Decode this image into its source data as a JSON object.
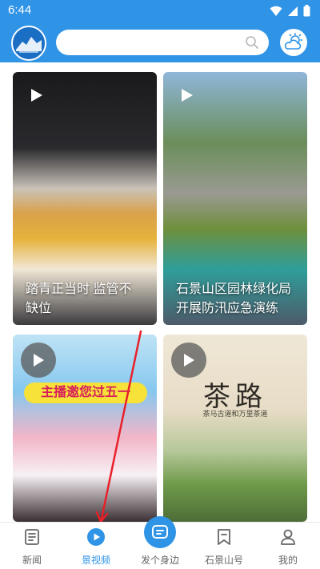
{
  "status_bar": {
    "time": "6:44"
  },
  "header": {
    "search": {
      "value": "",
      "placeholder": ""
    },
    "icons": {
      "logo": "app-logo-icon",
      "search": "search-icon",
      "weather": "weather-icon"
    }
  },
  "feed": {
    "cards": [
      {
        "caption": "踏青正当时 监管不缺位",
        "icon": "play-icon"
      },
      {
        "caption": "石景山区园林绿化局开展防汛应急演练",
        "icon": "play-icon"
      },
      {
        "banner": "主播邀您过五一",
        "icon": "play-icon"
      },
      {
        "title": "茶路",
        "subtitle": "茶马古道和万里茶道",
        "icon": "play-icon"
      }
    ]
  },
  "tabbar": {
    "tabs": [
      {
        "label": "新闻",
        "icon": "news-icon",
        "active": false
      },
      {
        "label": "景视频",
        "icon": "video-play-icon",
        "active": true
      },
      {
        "label": "发个身边",
        "icon": "post-icon",
        "active": false
      },
      {
        "label": "石景山号",
        "icon": "bookmark-icon",
        "active": false
      },
      {
        "label": "我的",
        "icon": "profile-icon",
        "active": false
      }
    ]
  },
  "colors": {
    "brand": "#2f93e6",
    "tab_inactive": "#666666",
    "annotation_arrow": "#e8202a"
  }
}
